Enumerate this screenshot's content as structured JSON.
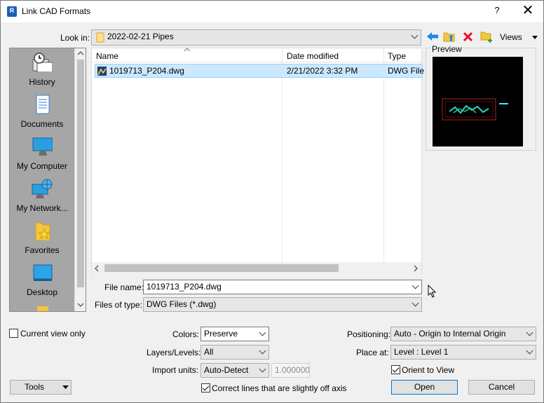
{
  "window": {
    "app_icon_letter": "R",
    "title": "Link CAD Formats",
    "help": "?",
    "close": "✕"
  },
  "look_in": {
    "label": "Look in:",
    "value": "2022-02-21 Pipes",
    "views_label": "Views"
  },
  "places": [
    {
      "label": "History",
      "icon": "history-icon"
    },
    {
      "label": "Documents",
      "icon": "documents-icon"
    },
    {
      "label": "My Computer",
      "icon": "computer-icon"
    },
    {
      "label": "My Network...",
      "icon": "network-icon"
    },
    {
      "label": "Favorites",
      "icon": "favorites-icon"
    },
    {
      "label": "Desktop",
      "icon": "desktop-icon"
    }
  ],
  "file_list": {
    "columns": [
      "Name",
      "Date modified",
      "Type"
    ],
    "rows": [
      {
        "name": "1019713_P204.dwg",
        "date": "2/21/2022 3:32 PM",
        "type": "DWG File"
      }
    ]
  },
  "preview": {
    "label": "Preview"
  },
  "file_name": {
    "label": "File name:",
    "value": "1019713_P204.dwg"
  },
  "files_of_type": {
    "label": "Files of type:",
    "value": "DWG Files  (*.dwg)"
  },
  "options": {
    "current_view_only": {
      "label": "Current view only",
      "checked": false
    },
    "colors": {
      "label": "Colors:",
      "value": "Preserve"
    },
    "layers": {
      "label": "Layers/Levels:",
      "value": "All"
    },
    "import_units": {
      "label": "Import units:",
      "value": "Auto-Detect",
      "scale": "1.000000"
    },
    "correct_lines": {
      "label": "Correct lines that are slightly off axis",
      "checked": true
    },
    "positioning": {
      "label": "Positioning:",
      "value": "Auto - Origin to Internal Origin"
    },
    "place_at": {
      "label": "Place at:",
      "value": "Level : Level 1"
    },
    "orient_to_view": {
      "label": "Orient to View",
      "checked": true
    }
  },
  "buttons": {
    "tools": "Tools",
    "open": "Open",
    "cancel": "Cancel"
  },
  "colors": {
    "selection_bg": "#cce8ff",
    "selection_border": "#99d1ff",
    "places_bg": "#a6a6a6",
    "accent_blue": "#0078d7",
    "delete_red": "#e81123",
    "folder_yellow": "#f4c542"
  }
}
